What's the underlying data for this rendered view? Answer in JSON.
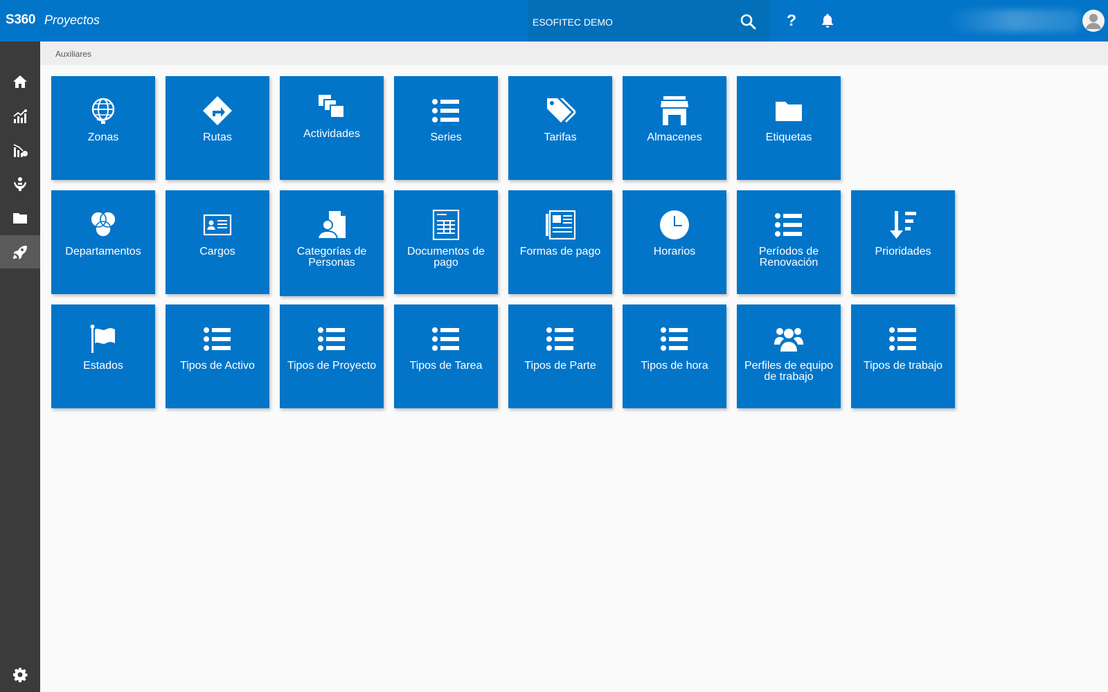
{
  "header": {
    "brand": "S360",
    "module": "Proyectos",
    "company": "ESOFITEC DEMO",
    "help_label": "?"
  },
  "breadcrumb": "Auxiliares",
  "sidebar": {
    "items": [
      "home-icon",
      "chart-icon",
      "analytics-icon",
      "hand-icon",
      "folder-icon",
      "rocket-icon"
    ],
    "active": "rocket-icon",
    "settings": "gear-icon"
  },
  "tiles": {
    "zonas": "Zonas",
    "rutas": "Rutas",
    "actividades": "Actividades",
    "series": "Series",
    "tarifas": "Tarifas",
    "almacenes": "Almacenes",
    "etiquetas": "Etiquetas",
    "departamentos": "Departamentos",
    "cargos": "Cargos",
    "categorias": "Categorías de Personas",
    "documentos": "Documentos de pago",
    "formas": "Formas de pago",
    "horarios": "Horarios",
    "periodos": "Períodos de Renovación",
    "prioridades": "Prioridades",
    "estados": "Estados",
    "tipos_activo": "Tipos de Activo",
    "tipos_proyecto": "Tipos de Proyecto",
    "tipos_tarea": "Tipos de Tarea",
    "tipos_parte": "Tipos de Parte",
    "tipos_hora": "Tipos de hora",
    "perfiles": "Perfiles de equipo de trabajo",
    "tipos_trabajo": "Tipos de trabajo"
  },
  "colors": {
    "primary": "#0275c9",
    "sidebar": "#3b3b3b",
    "background": "#fafafa"
  }
}
